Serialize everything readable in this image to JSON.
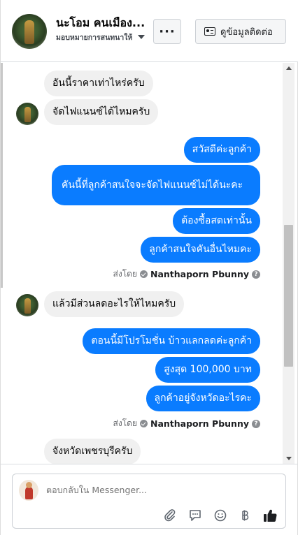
{
  "header": {
    "name": "นะโอม คนเมือง...",
    "subtitle": "มอบหมายการสนทนาให้",
    "more_label": "···",
    "contact_label": "ดูข้อมูลติดต่อ"
  },
  "messages": [
    {
      "text": "อันนี้ราคาเท่าไหร่ครับ"
    },
    {
      "text": "จัดไฟแนนซ์ได้ไหมครับ"
    },
    {
      "text": "สวัสดีค่ะลูกค้า"
    },
    {
      "text": "คันนี้ที่ลูกค้าสนใจจะจัดไฟแนนซ์ไม่ได้นะคะ"
    },
    {
      "text": "ต้องซื้อสดเท่านั้น"
    },
    {
      "text": "ลูกค้าสนใจคันอื่นไหมคะ"
    },
    {
      "text": "แล้วมีส่วนลดอะไรให้ไหมครับ"
    },
    {
      "text": "ตอนนี้มีโปรโมชั่น บ้าวแลกลดค่ะลูกค้า"
    },
    {
      "text": "สูงสุด 100,000 บาท"
    },
    {
      "text": "ลูกค้าอยู่จังหวัดอะไรคะ"
    },
    {
      "text": "จังหวัดเพชรบุรีครับ"
    }
  ],
  "sent_by": {
    "prefix": "ส่งโดย",
    "name": "Nanthaporn Pbunny",
    "help": "?"
  },
  "composer": {
    "placeholder": "ตอบกลับใน Messenger...",
    "icons": [
      "attach-icon",
      "saved-reply-icon",
      "emoji-icon",
      "baht-icon",
      "like-icon"
    ]
  },
  "colors": {
    "outgoing_bubble": "#0a7cff",
    "incoming_bubble": "#f0f0f0"
  }
}
